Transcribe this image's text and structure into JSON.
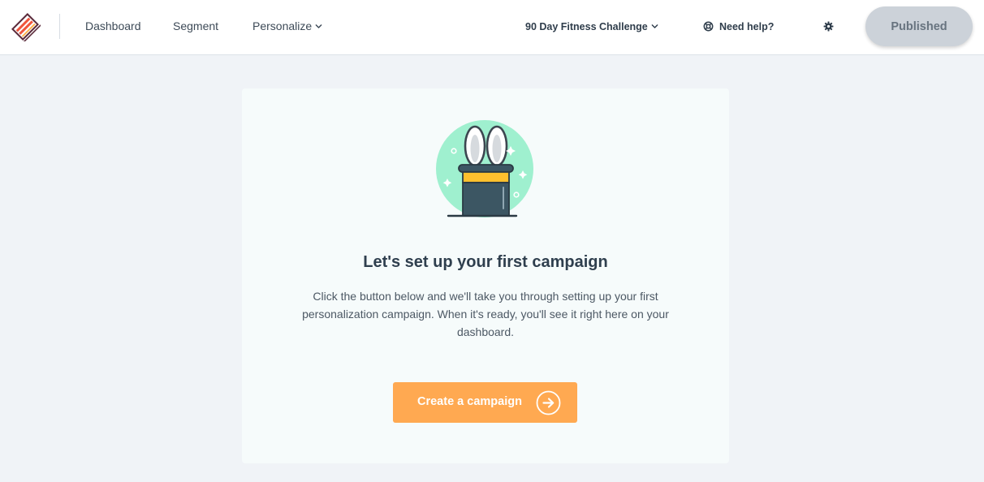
{
  "topbar": {
    "nav": {
      "dashboard": "Dashboard",
      "segment": "Segment",
      "personalize": "Personalize"
    },
    "project": "90 Day Fitness Challenge",
    "help": "Need help?",
    "status_button": "Published"
  },
  "card": {
    "title": "Let's set up your first campaign",
    "body": "Click the button below and we'll take you through setting up your first personalization campaign. When it's ready, you'll see it right here on your dashboard.",
    "cta": "Create a campaign"
  },
  "icons": {
    "logo": "brand-logo",
    "help": "lifebuoy-icon",
    "settings": "gear-icon",
    "dropdown": "chevron-down-icon",
    "cta": "arrow-right-circle-icon",
    "illustration": "magic-hat-rabbit-illustration"
  },
  "colors": {
    "accent": "#ffa951",
    "page_bg": "#f0f3f7",
    "card_bg": "#f6fbfb",
    "published_bg": "#ccd2d9",
    "illustration_mint": "#9ff0cf",
    "hat": "#3c5663",
    "hat_band": "#ffc02e"
  }
}
